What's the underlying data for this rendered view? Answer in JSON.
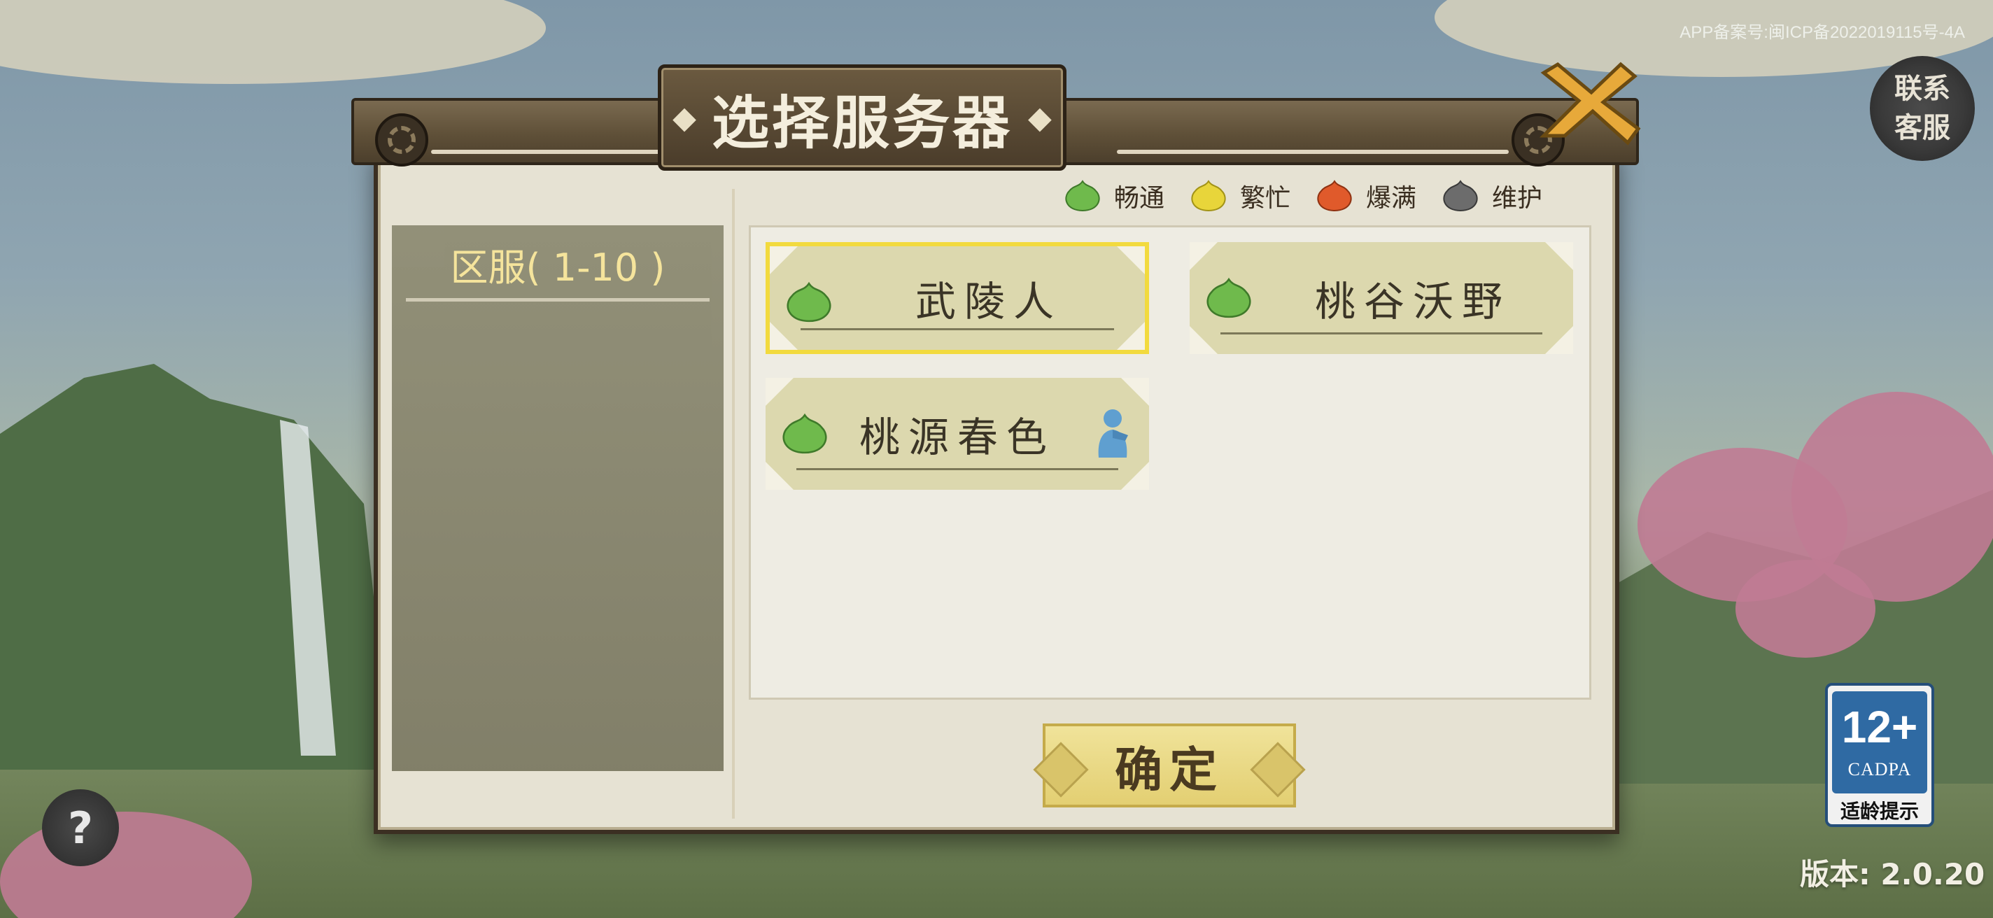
{
  "header": {
    "icp_text": "APP备案号:闽ICP备2022019115号-4A",
    "customer_service": [
      "联系",
      "客服"
    ]
  },
  "dialog": {
    "title": "选择服务器",
    "legend": [
      {
        "label": "畅通",
        "color": "#6fba4c"
      },
      {
        "label": "繁忙",
        "color": "#e8d53a"
      },
      {
        "label": "爆满",
        "color": "#e05a2b"
      },
      {
        "label": "维护",
        "color": "#6c6c6c"
      }
    ],
    "zones": [
      {
        "label": "区服( 1-10 )"
      }
    ],
    "servers": [
      {
        "name": "武陵人",
        "status_color": "#6fba4c",
        "selected": true,
        "has_role": false
      },
      {
        "name": "桃谷沃野",
        "status_color": "#6fba4c",
        "selected": false,
        "has_role": false
      },
      {
        "name": "桃源春色",
        "status_color": "#6fba4c",
        "selected": false,
        "has_role": true
      }
    ],
    "confirm_label": "确定"
  },
  "footer": {
    "help_symbol": "?",
    "age_rating": "12+",
    "age_org": "CADPA",
    "age_hint": "适龄提示",
    "version": "版本: 2.0.20"
  },
  "colors": {
    "selected_border": "#f2da3e",
    "zone_text": "#f6e59a",
    "role_icon": "#5f9fd0"
  }
}
